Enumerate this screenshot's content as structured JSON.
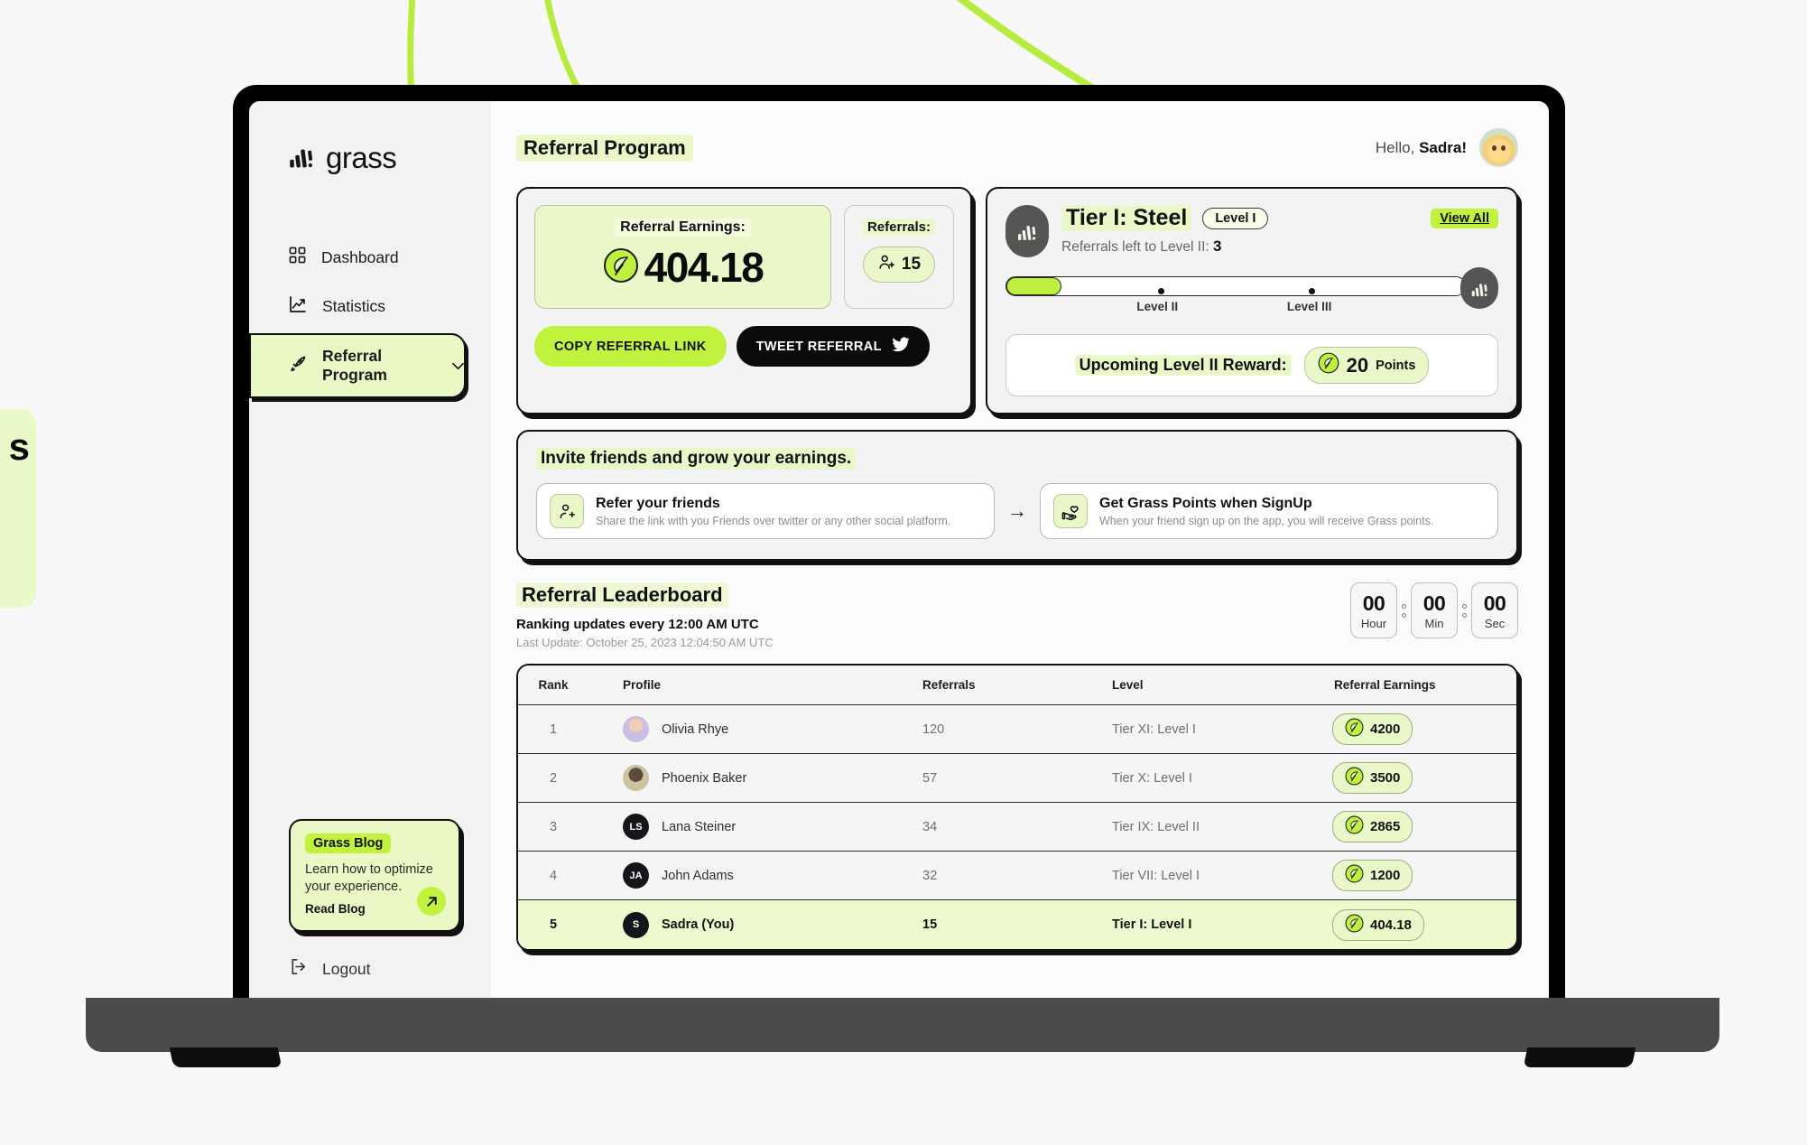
{
  "brand": {
    "name": "grass",
    "logo_icon": "bars-logo-icon"
  },
  "sidebar": {
    "items": [
      {
        "label": "Dashboard",
        "icon": "grid-icon",
        "active": false
      },
      {
        "label": "Statistics",
        "icon": "trend-chart-icon",
        "active": false
      },
      {
        "label": "Referral Program",
        "icon": "rocket-icon",
        "active": true,
        "chevron": "⌄"
      }
    ],
    "blog": {
      "tag": "Grass Blog",
      "description": "Learn how to optimize your experience.",
      "cta": "Read Blog",
      "arrow_icon": "arrow-up-right-icon"
    },
    "logout": {
      "label": "Logout",
      "icon": "logout-icon"
    }
  },
  "header": {
    "page_title": "Referral Program",
    "greeting_prefix": "Hello, ",
    "greeting_name": "Sadra!",
    "avatar_icon": "user-avatar"
  },
  "earnings_card": {
    "earnings_label": "Referral Earnings:",
    "earnings_value": "404.18",
    "referrals_label": "Referrals:",
    "referrals_value": "15",
    "copy_button": "COPY REFERRAL LINK",
    "tweet_button": "TWEET REFERRAL"
  },
  "tier_card": {
    "tier_title": "Tier I: Steel",
    "level_badge": "Level I",
    "view_all": "View All",
    "referrals_left_label": "Referrals left to Level II:",
    "referrals_left_value": "3",
    "progress_percent": 12,
    "milestones": [
      {
        "label": "Level II",
        "position_percent": 33
      },
      {
        "label": "Level III",
        "position_percent": 66
      }
    ],
    "reward_label": "Upcoming Level II Reward:",
    "reward_value": "20",
    "reward_unit": "Points"
  },
  "invite": {
    "title": "Invite friends and grow your earnings.",
    "steps": [
      {
        "icon": "user-plus-icon",
        "heading": "Refer your friends",
        "description": "Share the link with you Friends over twitter or any other social platform."
      },
      {
        "icon": "hand-heart-icon",
        "heading": "Get Grass Points when SignUp",
        "description": "When your friend sign up on the app, you will receive Grass points."
      }
    ],
    "arrow": "→"
  },
  "leaderboard": {
    "title": "Referral Leaderboard",
    "subtitle": "Ranking updates every 12:00 AM UTC",
    "last_update": "Last Update: October 25, 2023 12:04:50 AM UTC",
    "timer": [
      {
        "value": "00",
        "unit": "Hour"
      },
      {
        "value": "00",
        "unit": "Min"
      },
      {
        "value": "00",
        "unit": "Sec"
      }
    ],
    "columns": [
      "Rank",
      "Profile",
      "Referrals",
      "Level",
      "Referral Earnings"
    ],
    "rows": [
      {
        "rank": "1",
        "name": "Olivia Rhye",
        "initials": "",
        "referrals": "120",
        "level": "Tier XI: Level I",
        "earnings": "4200",
        "is_you": false
      },
      {
        "rank": "2",
        "name": "Phoenix Baker",
        "initials": "",
        "referrals": "57",
        "level": "Tier X: Level I",
        "earnings": "3500",
        "is_you": false
      },
      {
        "rank": "3",
        "name": "Lana Steiner",
        "initials": "LS",
        "referrals": "34",
        "level": "Tier IX: Level II",
        "earnings": "2865",
        "is_you": false
      },
      {
        "rank": "4",
        "name": "John Adams",
        "initials": "JA",
        "referrals": "32",
        "level": "Tier VII: Level I",
        "earnings": "1200",
        "is_you": false
      },
      {
        "rank": "5",
        "name": "Sadra (You)",
        "initials": "S",
        "referrals": "15",
        "level": "Tier I: Level I",
        "earnings": "404.18",
        "is_you": true
      }
    ]
  },
  "decor": {
    "edge_card_text": "s"
  },
  "colors": {
    "accent": "#c0f23e",
    "accent_soft": "#eaf8c9",
    "ink": "#111111"
  }
}
